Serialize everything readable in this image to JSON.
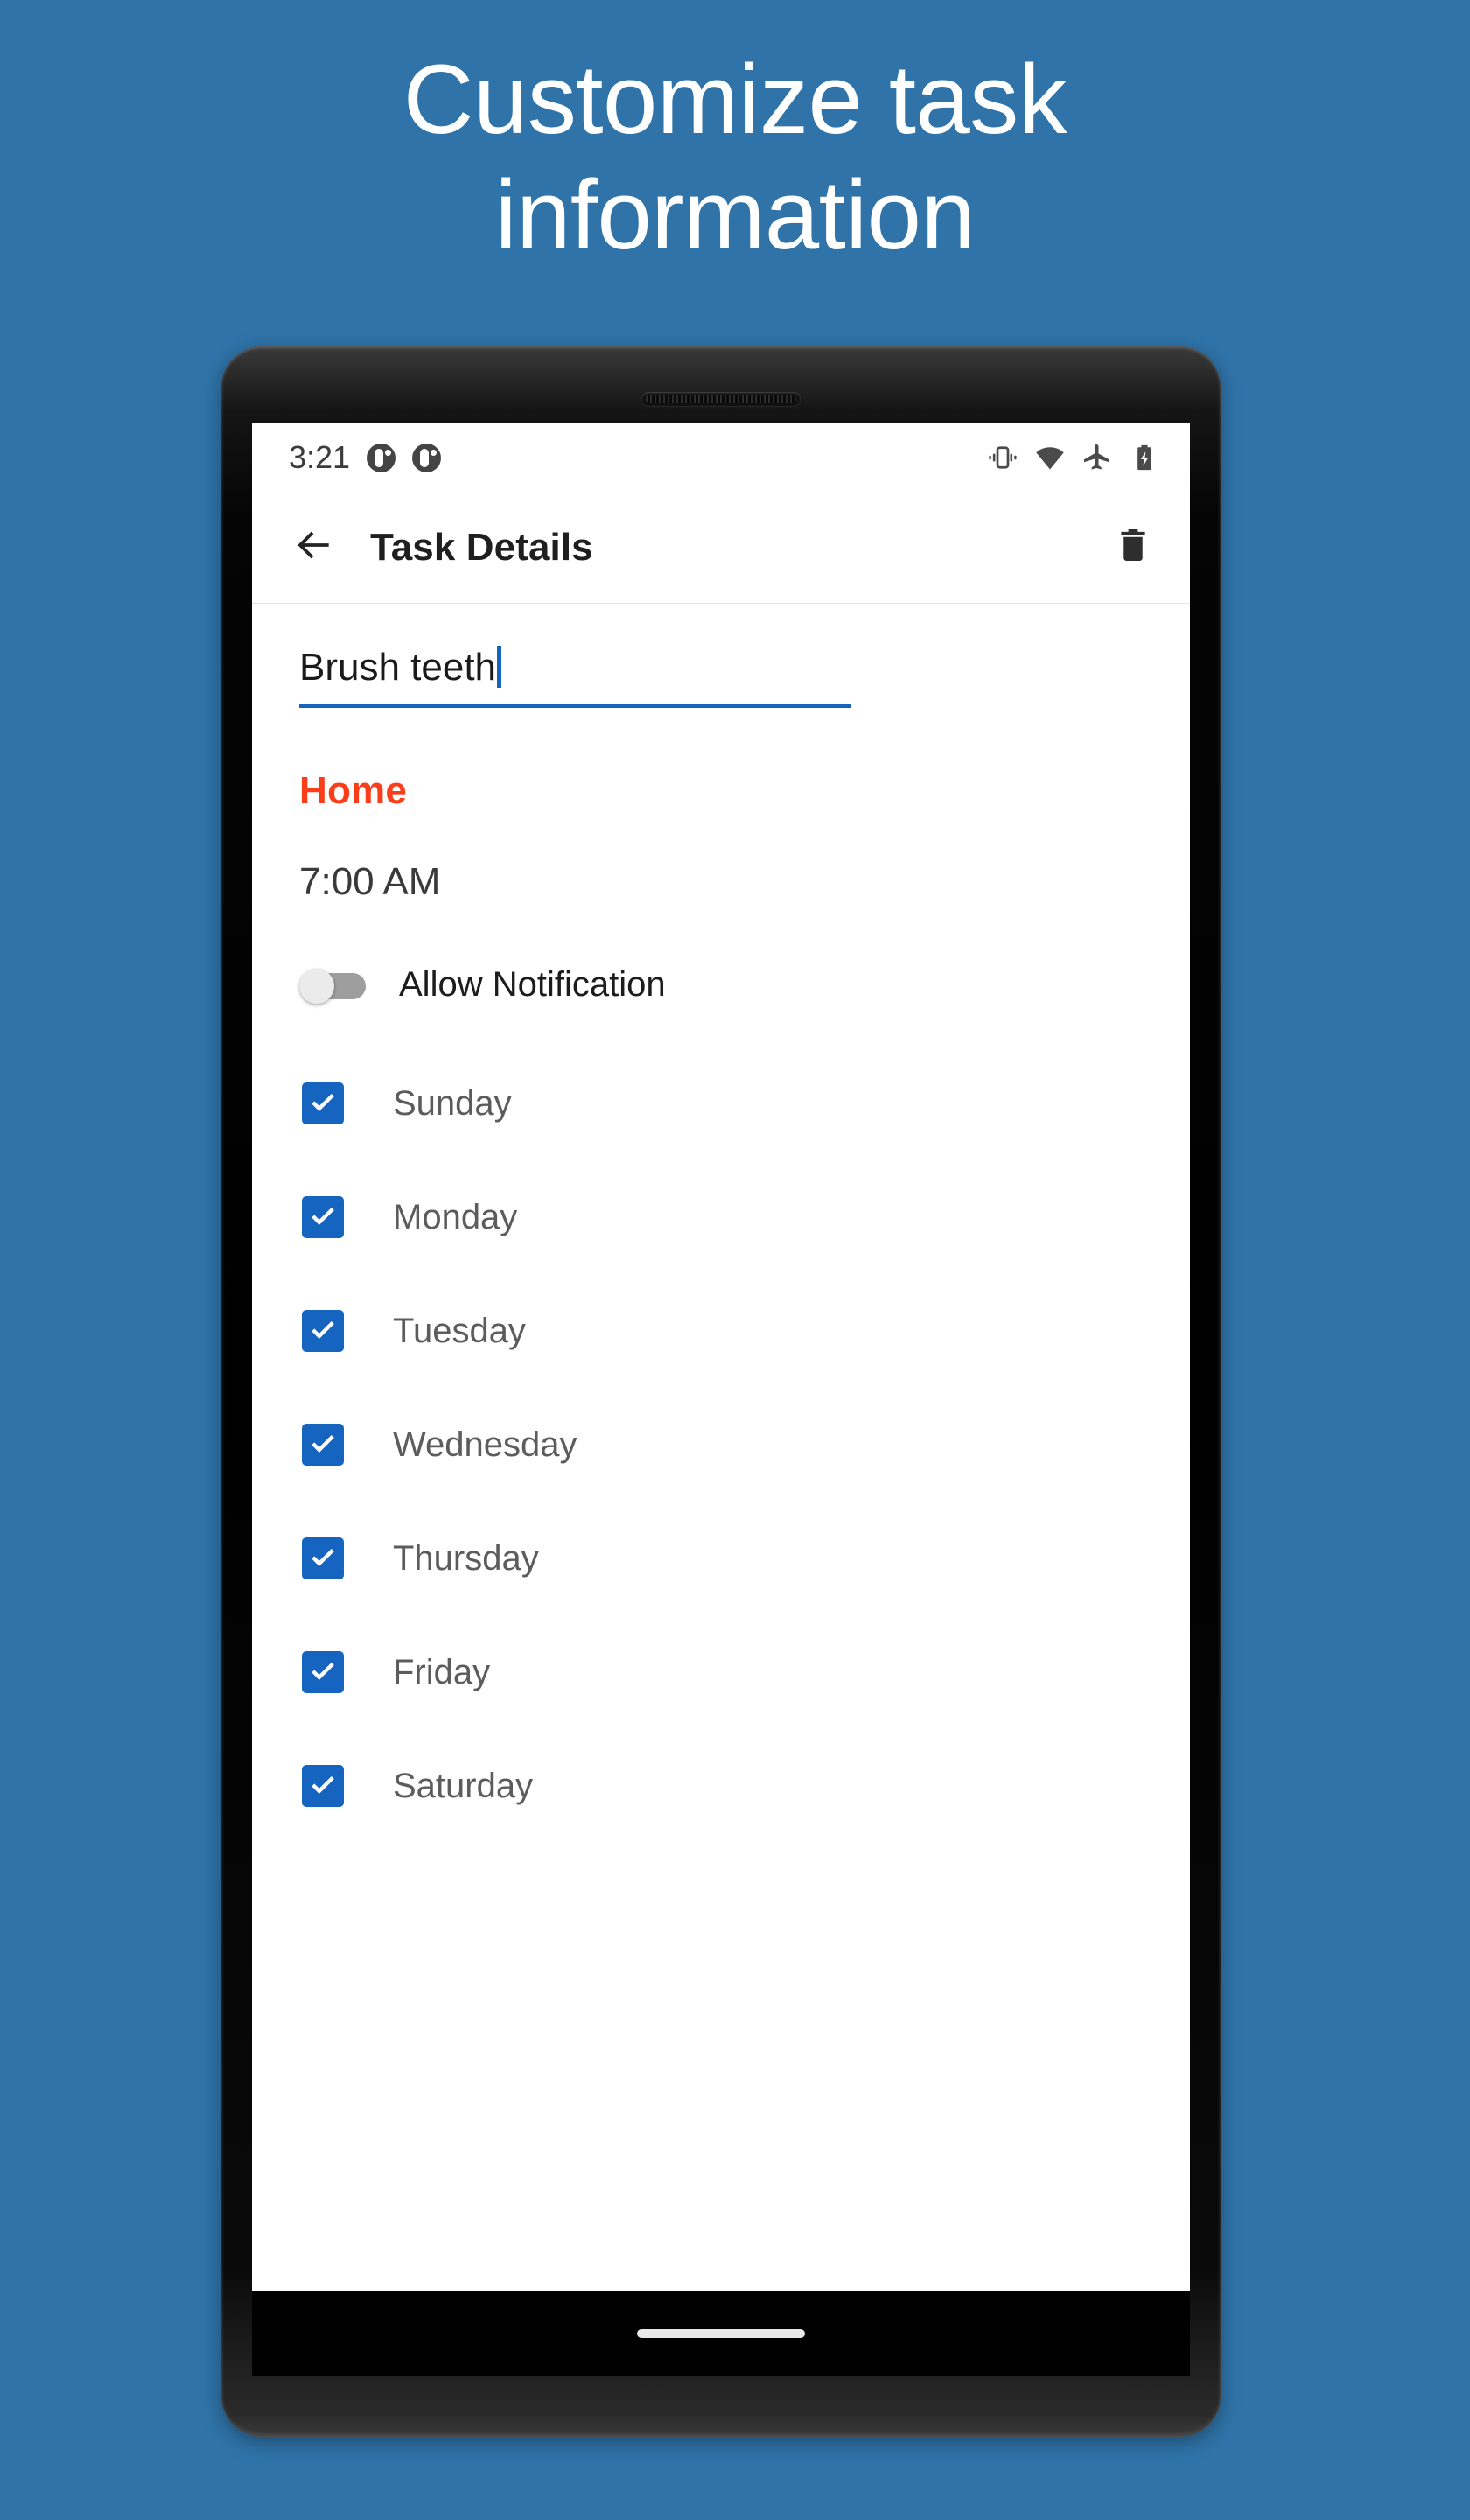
{
  "promo": {
    "headline": "Customize task\ninformation",
    "background_color": "#2F73A8",
    "text_color": "#FFFFFF"
  },
  "status_bar": {
    "clock": "3:21",
    "notification_icons": [
      "app-notification-icon",
      "app-notification-icon"
    ],
    "system_icons": [
      "vibrate-icon",
      "wifi-icon",
      "airplane-mode-icon",
      "battery-charging-icon"
    ]
  },
  "app_bar": {
    "back_icon": "back-arrow-icon",
    "title": "Task Details",
    "delete_icon": "trash-icon"
  },
  "task": {
    "title_value": "Brush teeth",
    "title_placeholder": "Task name",
    "category": "Home",
    "category_color": "#FC3D1A",
    "time": "7:00 AM",
    "notification": {
      "label": "Allow Notification",
      "enabled": false
    },
    "repeat_days": [
      {
        "label": "Sunday",
        "checked": true
      },
      {
        "label": "Monday",
        "checked": true
      },
      {
        "label": "Tuesday",
        "checked": true
      },
      {
        "label": "Wednesday",
        "checked": true
      },
      {
        "label": "Thursday",
        "checked": true
      },
      {
        "label": "Friday",
        "checked": true
      },
      {
        "label": "Saturday",
        "checked": true
      }
    ]
  },
  "theme": {
    "accent_blue": "#1565C0",
    "screen_background": "#FFFFFF",
    "label_gray": "#5C5C5C"
  },
  "nav_bar": {
    "gesture_handle": "gesture-pill"
  }
}
